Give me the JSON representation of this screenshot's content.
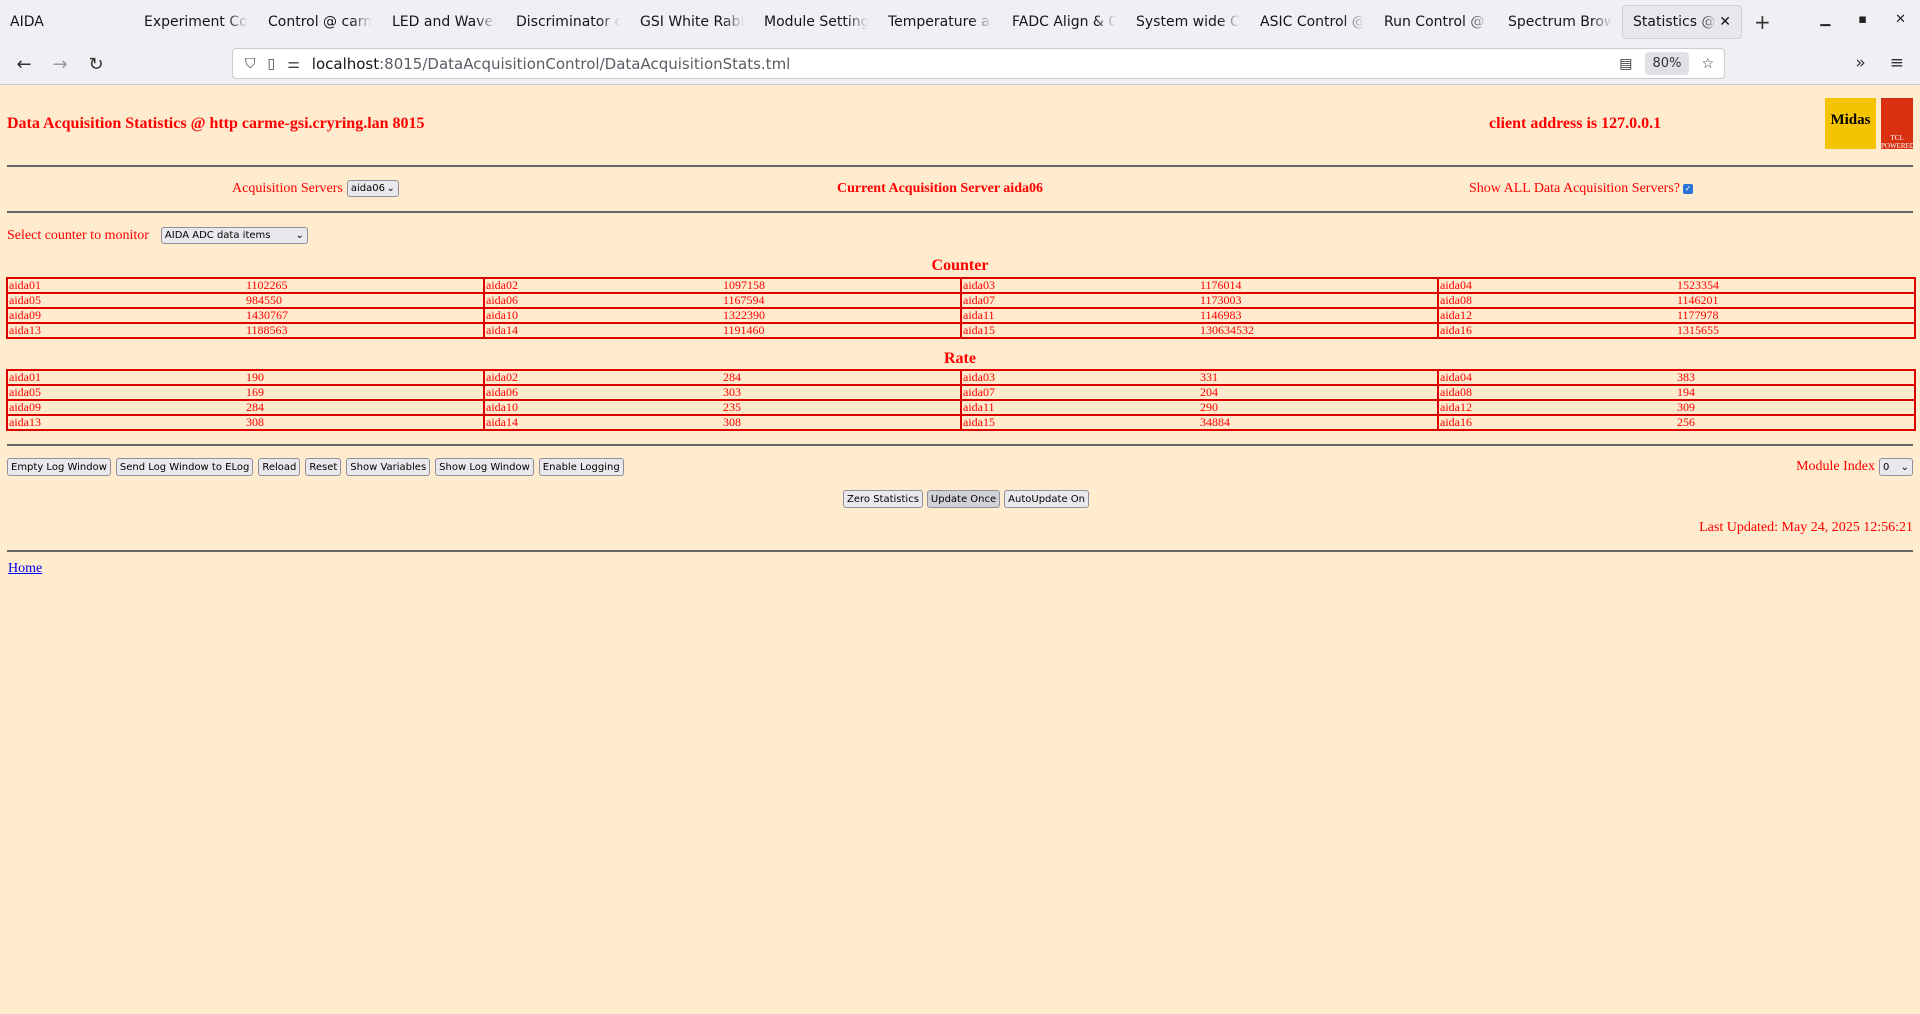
{
  "browser": {
    "app_name": "AIDA",
    "tabs": [
      "Experiment Con",
      "Control @ carm",
      "LED and Wavefo",
      "Discriminator co",
      "GSI White Rabbi",
      "Module Settings",
      "Temperature an",
      "FADC Align & C",
      "System wide Ch",
      "ASIC Control @",
      "Run Control @ c",
      "Spectrum Brows",
      "Statistics @ c"
    ],
    "active_tab": 12,
    "url_host": "localhost",
    "url_path": ":8015/DataAcquisitionControl/DataAcquisitionStats.tml",
    "zoom": "80%"
  },
  "page": {
    "title": "Data Acquisition Statistics @ http carme-gsi.cryring.lan 8015",
    "client": "client address is 127.0.0.1",
    "logo_midas": "Midas",
    "logo_tcl": "TCL POWERED",
    "servers_label": "Acquisition Servers",
    "servers_value": "aida06",
    "current_server": "Current Acquisition Server aida06",
    "show_all_label": "Show ALL Data Acquisition Servers?",
    "show_all_checked": true,
    "counter_label": "Select counter to monitor",
    "counter_value": "AIDA ADC data items",
    "counter_heading": "Counter",
    "rate_heading": "Rate",
    "counter": [
      [
        "aida01",
        "1102265"
      ],
      [
        "aida02",
        "1097158"
      ],
      [
        "aida03",
        "1176014"
      ],
      [
        "aida04",
        "1523354"
      ],
      [
        "aida05",
        "984550"
      ],
      [
        "aida06",
        "1167594"
      ],
      [
        "aida07",
        "1173003"
      ],
      [
        "aida08",
        "1146201"
      ],
      [
        "aida09",
        "1430767"
      ],
      [
        "aida10",
        "1322390"
      ],
      [
        "aida11",
        "1146983"
      ],
      [
        "aida12",
        "1177978"
      ],
      [
        "aida13",
        "1188563"
      ],
      [
        "aida14",
        "1191460"
      ],
      [
        "aida15",
        "130634532"
      ],
      [
        "aida16",
        "1315655"
      ]
    ],
    "rate": [
      [
        "aida01",
        "190"
      ],
      [
        "aida02",
        "284"
      ],
      [
        "aida03",
        "331"
      ],
      [
        "aida04",
        "383"
      ],
      [
        "aida05",
        "169"
      ],
      [
        "aida06",
        "303"
      ],
      [
        "aida07",
        "204"
      ],
      [
        "aida08",
        "194"
      ],
      [
        "aida09",
        "284"
      ],
      [
        "aida10",
        "235"
      ],
      [
        "aida11",
        "290"
      ],
      [
        "aida12",
        "309"
      ],
      [
        "aida13",
        "308"
      ],
      [
        "aida14",
        "308"
      ],
      [
        "aida15",
        "34884"
      ],
      [
        "aida16",
        "256"
      ]
    ],
    "buttons": [
      "Empty Log Window",
      "Send Log Window to ELog",
      "Reload",
      "Reset",
      "Show Variables",
      "Show Log Window",
      "Enable Logging"
    ],
    "module_index_label": "Module Index",
    "module_index_value": "0",
    "center_buttons": [
      "Zero Statistics",
      "Update Once",
      "AutoUpdate On"
    ],
    "last_updated": "Last Updated: May 24, 2025 12:56:21",
    "home_link": "Home"
  },
  "colors": {
    "background": "#ffebcd",
    "text": "#ff0000",
    "table_border": "#dd0000"
  }
}
